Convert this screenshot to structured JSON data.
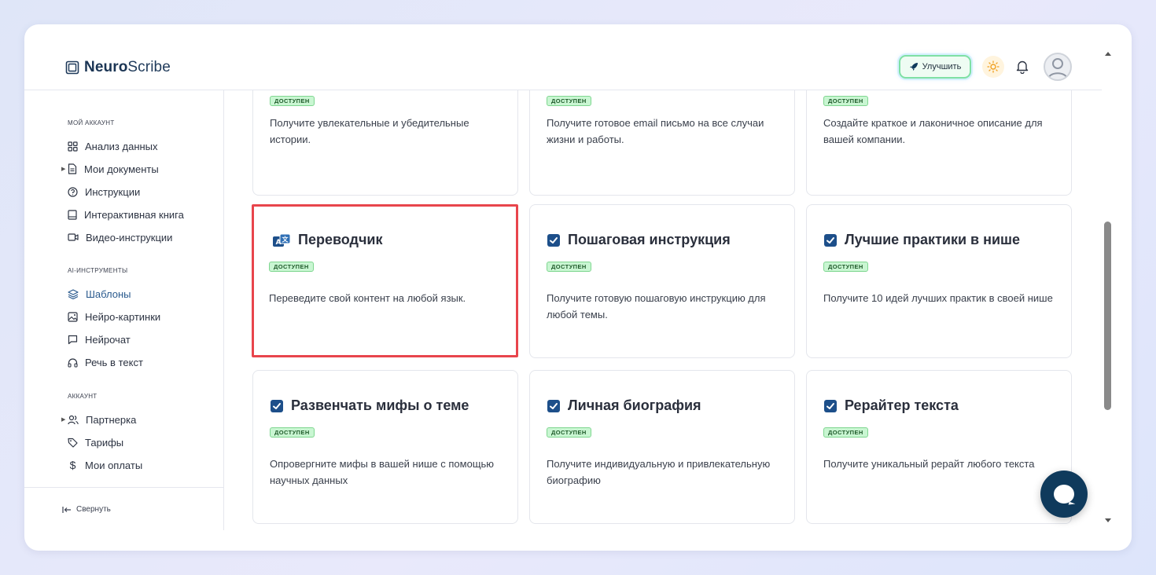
{
  "app": {
    "logo_bold": "Neuro",
    "logo_rest": "Scribe"
  },
  "header": {
    "upgrade_label": "Улучшить"
  },
  "sidebar": {
    "section_account": "МОЙ АККАУНТ",
    "items_account": [
      {
        "label": "Анализ данных",
        "icon": "grid-icon"
      },
      {
        "label": "Мои документы",
        "icon": "document-icon"
      },
      {
        "label": "Инструкции",
        "icon": "help-circle-icon"
      },
      {
        "label": "Интерактивная книга",
        "icon": "book-icon"
      },
      {
        "label": "Видео-инструкции",
        "icon": "video-icon"
      }
    ],
    "section_ai": "AI-ИНСТРУМЕНТЫ",
    "items_ai": [
      {
        "label": "Шаблоны",
        "icon": "layers-icon"
      },
      {
        "label": "Нейро-картинки",
        "icon": "image-icon"
      },
      {
        "label": "Нейрочат",
        "icon": "chat-icon"
      },
      {
        "label": "Речь в текст",
        "icon": "headphones-icon"
      }
    ],
    "section_user": "АККАУНТ",
    "items_user": [
      {
        "label": "Партнерка",
        "icon": "users-icon"
      },
      {
        "label": "Тарифы",
        "icon": "tag-icon"
      },
      {
        "label": "Мои оплаты",
        "icon": "dollar-icon"
      }
    ],
    "collapse_label": "Свернуть"
  },
  "cards": [
    {
      "title": "",
      "badge": "ДОСТУПЕН",
      "desc": "Получите увлекательные и убедительные истории."
    },
    {
      "title": "",
      "badge": "ДОСТУПЕН",
      "desc": "Получите готовое email письмо на все случаи жизни и работы."
    },
    {
      "title": "",
      "badge": "ДОСТУПЕН",
      "desc": "Создайте краткое и лаконичное описание для вашей компании."
    },
    {
      "title": "Переводчик",
      "badge": "ДОСТУПЕН",
      "desc": "Переведите свой контент на любой язык."
    },
    {
      "title": "Пошаговая инструкция",
      "badge": "ДОСТУПЕН",
      "desc": "Получите готовую пошаговую инструкцию для любой темы."
    },
    {
      "title": "Лучшие практики в нише",
      "badge": "ДОСТУПЕН",
      "desc": "Получите 10 идей лучших практик в своей нише"
    },
    {
      "title": "Развенчать мифы о теме",
      "badge": "ДОСТУПЕН",
      "desc": "Опровергните мифы в вашей нише с помощью научных данных"
    },
    {
      "title": "Личная биография",
      "badge": "ДОСТУПЕН",
      "desc": "Получите индивидуальную и привлекательную биографию"
    },
    {
      "title": "Рерайтер текста",
      "badge": "ДОСТУПЕН",
      "desc": "Получите уникальный рерайт любого текста"
    }
  ]
}
